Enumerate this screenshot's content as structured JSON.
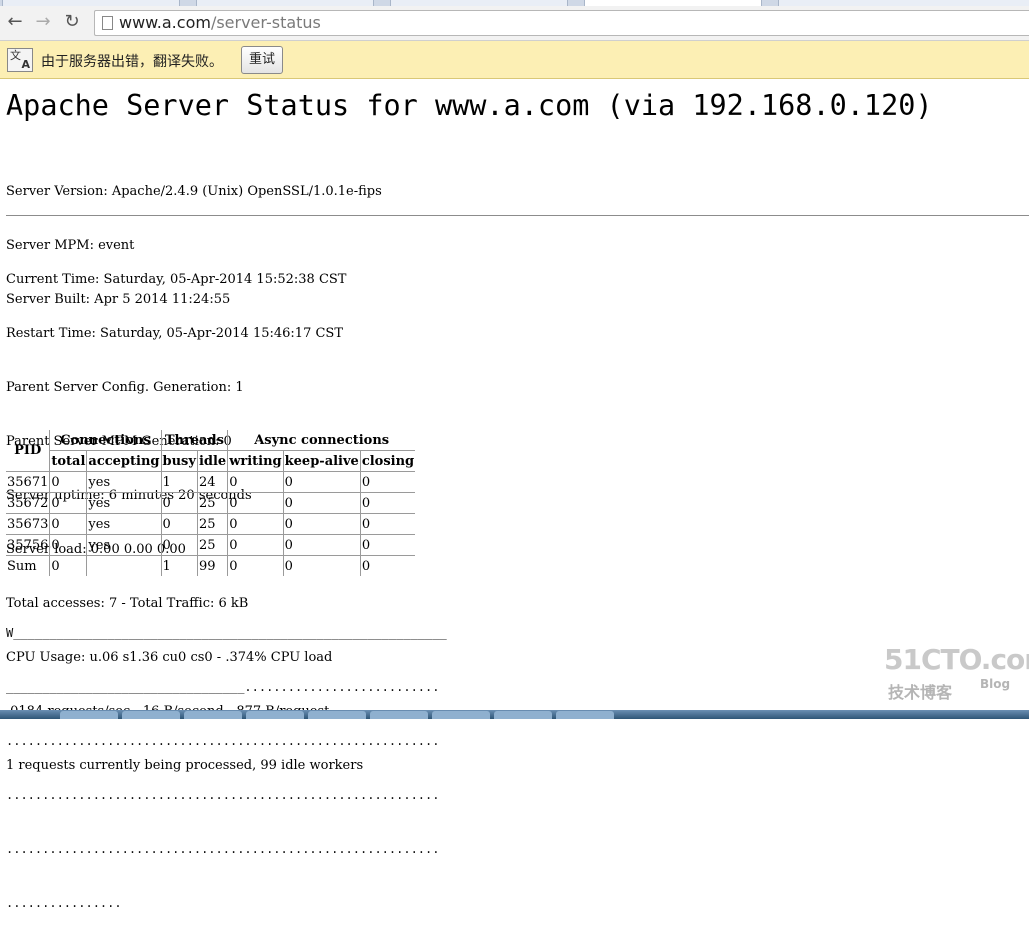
{
  "browser": {
    "url_host": "www.a.com",
    "url_path": "/server-status"
  },
  "infobar": {
    "message": "由于服务器出错，翻译失败。",
    "retry_label": "重试"
  },
  "page": {
    "title": "Apache Server Status for www.a.com (via 192.168.0.120)",
    "server_info": [
      "Server Version: Apache/2.4.9 (Unix) OpenSSL/1.0.1e-fips",
      "Server MPM: event",
      "Server Built: Apr 5 2014 11:24:55"
    ],
    "status_lines": [
      "Current Time: Saturday, 05-Apr-2014 15:52:38 CST",
      "Restart Time: Saturday, 05-Apr-2014 15:46:17 CST",
      "Parent Server Config. Generation: 1",
      "Parent Server MPM Generation: 0",
      "Server uptime: 6 minutes 20 seconds",
      "Server load: 0.00 0.00 0.00",
      "Total accesses: 7 - Total Traffic: 6 kB",
      "CPU Usage: u.06 s1.36 cu0 cs0 - .374% CPU load",
      ".0184 requests/sec - 16 B/second - 877 B/request",
      "1 requests currently being processed, 99 idle workers"
    ],
    "table": {
      "group_headers": [
        "PID",
        "Connections",
        "Threads",
        "Async connections"
      ],
      "sub_headers": [
        "total",
        "accepting",
        "busy",
        "idle",
        "writing",
        "keep-alive",
        "closing"
      ],
      "rows": [
        [
          "35671",
          "0",
          "yes",
          "1",
          "24",
          "0",
          "0",
          "0"
        ],
        [
          "35672",
          "0",
          "yes",
          "0",
          "25",
          "0",
          "0",
          "0"
        ],
        [
          "35673",
          "0",
          "yes",
          "0",
          "25",
          "0",
          "0",
          "0"
        ],
        [
          "35756",
          "0",
          "yes",
          "0",
          "25",
          "0",
          "0",
          "0"
        ],
        [
          "Sum",
          "0",
          "",
          "1",
          "99",
          "0",
          "0",
          "0"
        ]
      ]
    },
    "scoreboard": [
      "W____________________________________________________________",
      "_________________________________........................... ",
      "............................................................ ",
      "............................................................ ",
      "............................................................ ",
      "................"
    ]
  },
  "watermark": {
    "logo": "51CTO.com",
    "sub": "技术博客",
    "blog": "Blog"
  }
}
